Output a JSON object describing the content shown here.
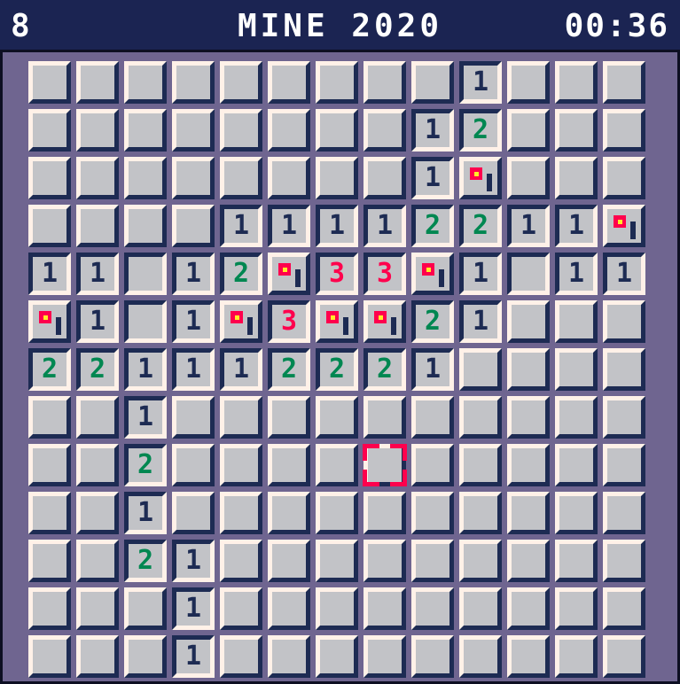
{
  "hud": {
    "mine_count": "8",
    "title": "MINE 2020",
    "timer": "00:36"
  },
  "grid": {
    "rows": 13,
    "cols": 13,
    "legend": "c = covered, f = flagged, r = revealed empty, 1/2/3 = revealed number",
    "cells": [
      [
        "c",
        "c",
        "c",
        "c",
        "c",
        "c",
        "c",
        "c",
        "c",
        "1",
        "c",
        "c",
        "c"
      ],
      [
        "c",
        "c",
        "c",
        "c",
        "c",
        "c",
        "c",
        "c",
        "1",
        "2",
        "c",
        "c",
        "c"
      ],
      [
        "c",
        "c",
        "c",
        "c",
        "c",
        "c",
        "c",
        "c",
        "1",
        "f",
        "c",
        "c",
        "c"
      ],
      [
        "c",
        "c",
        "c",
        "c",
        "1",
        "1",
        "1",
        "1",
        "2",
        "2",
        "1",
        "1",
        "f"
      ],
      [
        "1",
        "1",
        "r",
        "1",
        "2",
        "f",
        "3",
        "3",
        "f",
        "1",
        "r",
        "1",
        "1"
      ],
      [
        "f",
        "1",
        "r",
        "1",
        "f",
        "3",
        "f",
        "f",
        "2",
        "1",
        "c",
        "c",
        "c"
      ],
      [
        "2",
        "2",
        "1",
        "1",
        "1",
        "2",
        "2",
        "2",
        "1",
        "c",
        "c",
        "c",
        "c"
      ],
      [
        "c",
        "c",
        "1",
        "c",
        "c",
        "c",
        "c",
        "c",
        "c",
        "c",
        "c",
        "c",
        "c"
      ],
      [
        "c",
        "c",
        "2",
        "c",
        "c",
        "c",
        "c",
        "c",
        "c",
        "c",
        "c",
        "c",
        "c"
      ],
      [
        "c",
        "c",
        "1",
        "c",
        "c",
        "c",
        "c",
        "c",
        "c",
        "c",
        "c",
        "c",
        "c"
      ],
      [
        "c",
        "c",
        "2",
        "1",
        "c",
        "c",
        "c",
        "c",
        "c",
        "c",
        "c",
        "c",
        "c"
      ],
      [
        "c",
        "c",
        "c",
        "1",
        "c",
        "c",
        "c",
        "c",
        "c",
        "c",
        "c",
        "c",
        "c"
      ],
      [
        "c",
        "c",
        "c",
        "1",
        "c",
        "c",
        "c",
        "c",
        "c",
        "c",
        "c",
        "c",
        "c"
      ]
    ],
    "cursor": {
      "row": 8,
      "col": 7
    }
  },
  "colors": {
    "topbar": "#1b2452",
    "board": "#6f6590",
    "tile": "#c2c3c7",
    "highlight": "#fff1e8",
    "shadow": "#1d2b53",
    "number_1": "#1d2b53",
    "number_2": "#008751",
    "number_3": "#ff004d",
    "flag": "#ff004d",
    "flag_center": "#ffec27",
    "cursor": "#ff004d"
  },
  "icons": {
    "flag": "flag-icon",
    "cursor": "selection-cursor-icon"
  }
}
